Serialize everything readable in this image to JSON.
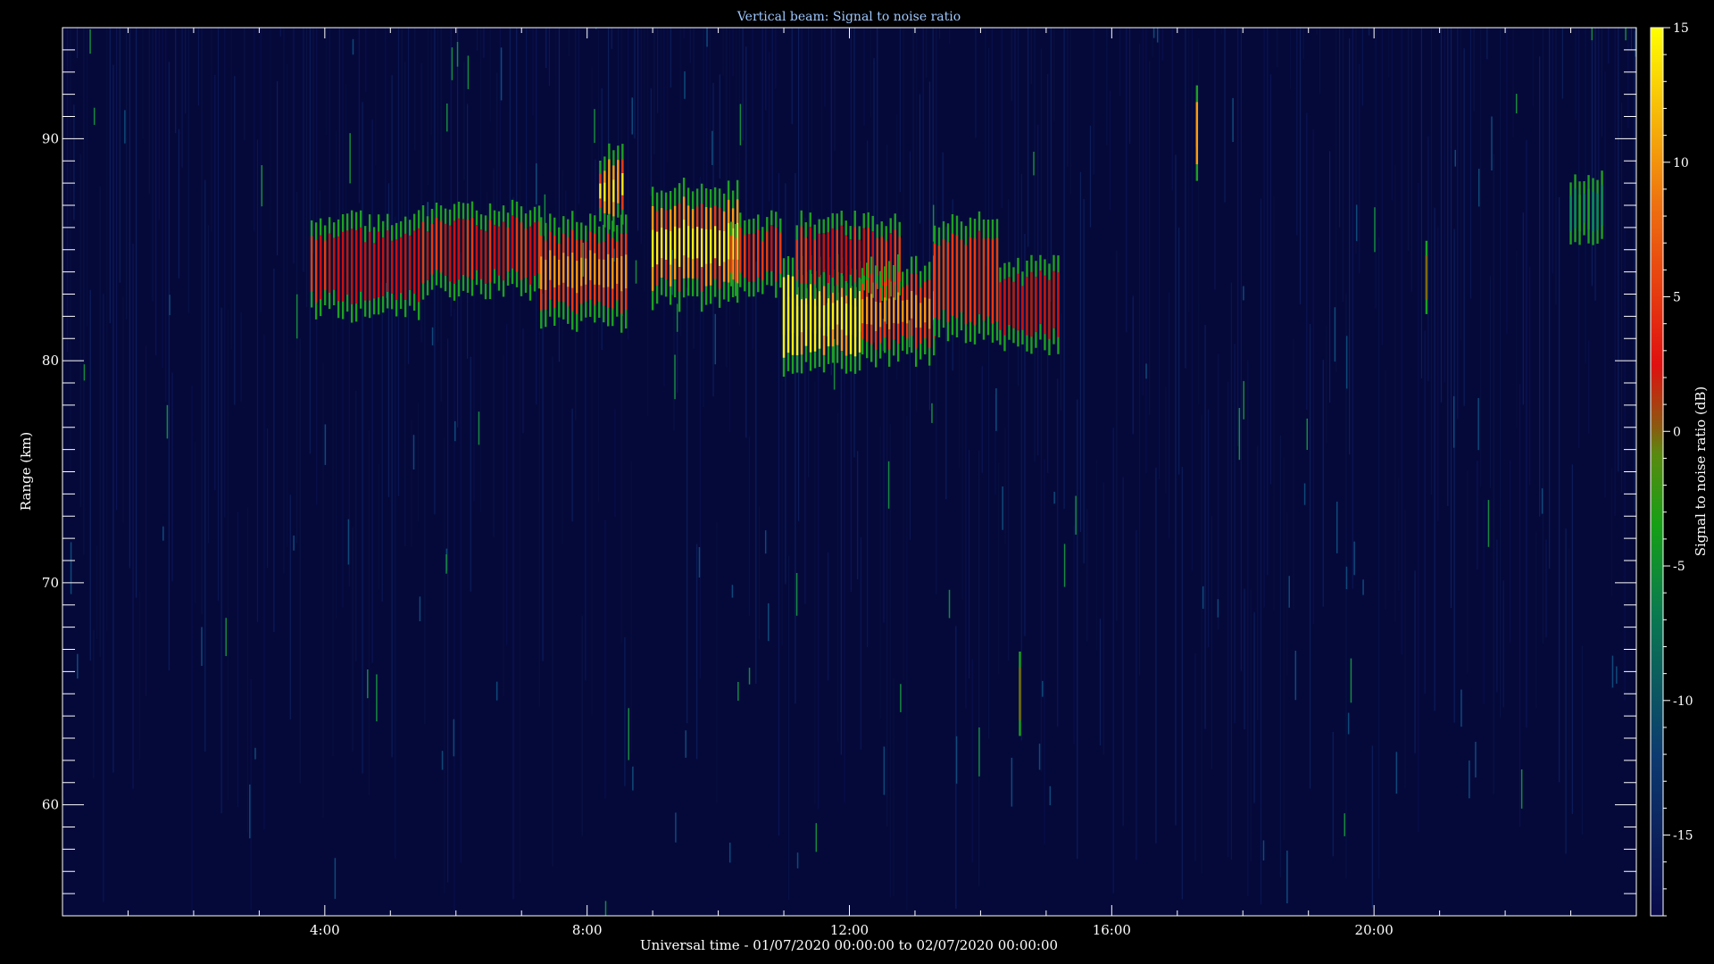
{
  "chart_data": {
    "type": "heatmap",
    "title": "Vertical beam: Signal to noise ratio",
    "xlabel": "Universal time - 01/07/2020 00:00:00 to 02/07/2020 00:00:00",
    "ylabel": "Range (km)",
    "colorbar_label": "Signal to noise ratio (dB)",
    "xlim": [
      0,
      24
    ],
    "ylim": [
      55,
      95
    ],
    "clim": [
      -18,
      15
    ],
    "x_ticks": [
      {
        "value": 4,
        "label": "4:00"
      },
      {
        "value": 8,
        "label": "8:00"
      },
      {
        "value": 12,
        "label": "12:00"
      },
      {
        "value": 16,
        "label": "16:00"
      },
      {
        "value": 20,
        "label": "20:00"
      }
    ],
    "y_ticks": [
      {
        "value": 60,
        "label": "60"
      },
      {
        "value": 70,
        "label": "70"
      },
      {
        "value": 80,
        "label": "80"
      },
      {
        "value": 90,
        "label": "90"
      }
    ],
    "colorbar_ticks": [
      {
        "value": -15,
        "label": "-15"
      },
      {
        "value": -10,
        "label": "-10"
      },
      {
        "value": -5,
        "label": "-5"
      },
      {
        "value": 0,
        "label": "0"
      },
      {
        "value": 5,
        "label": "5"
      },
      {
        "value": 10,
        "label": "10"
      },
      {
        "value": 15,
        "label": "15"
      }
    ],
    "colormap": [
      "#0a0a4a",
      "#0d3a70",
      "#0a7a50",
      "#16a016",
      "#5a8a10",
      "#8a5a10",
      "#e01010",
      "#ee7010",
      "#ffff00"
    ],
    "grid": false,
    "echo_regions": [
      {
        "t": [
          3.8,
          5.5
        ],
        "range": [
          82.5,
          86
        ],
        "snr": 3
      },
      {
        "t": [
          5.5,
          7.3
        ],
        "range": [
          83.5,
          86.5
        ],
        "snr": 4
      },
      {
        "t": [
          7.3,
          8.6
        ],
        "range": [
          82,
          86
        ],
        "snr": 6
      },
      {
        "t": [
          8.2,
          8.6
        ],
        "range": [
          86.5,
          89
        ],
        "snr": 8
      },
      {
        "t": [
          9.0,
          10.3
        ],
        "range": [
          83,
          87.5
        ],
        "snr": 9
      },
      {
        "t": [
          10.2,
          11.0
        ],
        "range": [
          83.5,
          86
        ],
        "snr": 5
      },
      {
        "t": [
          11.0,
          12.2
        ],
        "range": [
          80,
          84
        ],
        "snr": 11
      },
      {
        "t": [
          11.2,
          12.8
        ],
        "range": [
          83.5,
          86
        ],
        "snr": 4
      },
      {
        "t": [
          12.2,
          13.3
        ],
        "range": [
          80.5,
          84
        ],
        "snr": 6
      },
      {
        "t": [
          13.3,
          14.3
        ],
        "range": [
          81.5,
          86
        ],
        "snr": 5
      },
      {
        "t": [
          14.3,
          15.2
        ],
        "range": [
          81,
          84
        ],
        "snr": 3
      },
      {
        "t": [
          17.3,
          17.35
        ],
        "range": [
          88.5,
          92
        ],
        "snr": 8
      },
      {
        "t": [
          14.6,
          14.65
        ],
        "range": [
          63.5,
          66.5
        ],
        "snr": 2
      },
      {
        "t": [
          20.8,
          20.85
        ],
        "range": [
          82.5,
          85
        ],
        "snr": 1
      },
      {
        "t": [
          23.0,
          23.5
        ],
        "range": [
          86,
          88
        ],
        "snr": -6
      }
    ]
  }
}
